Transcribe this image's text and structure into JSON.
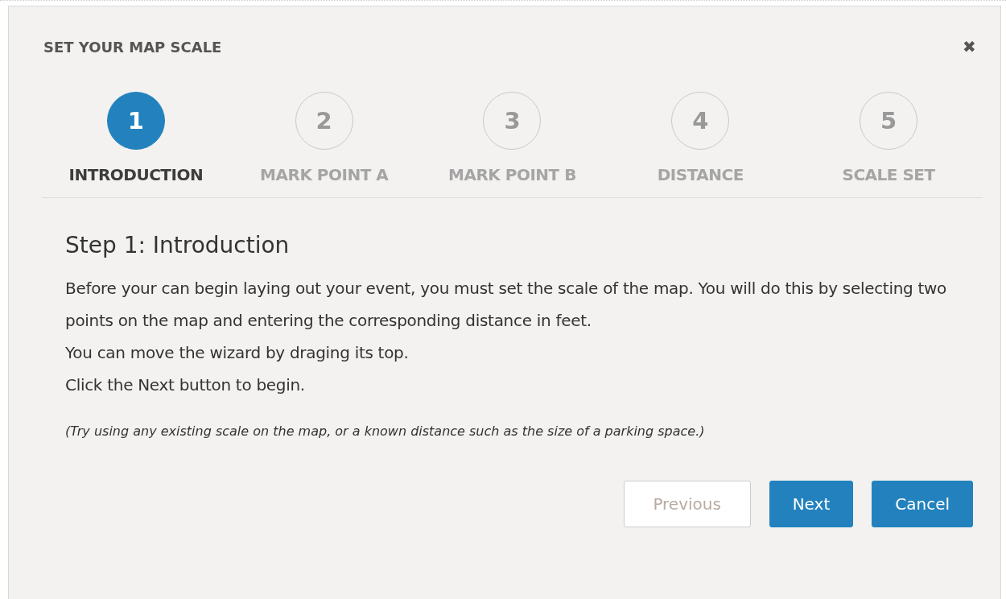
{
  "dialog": {
    "title": "SET YOUR MAP SCALE",
    "close": "✖"
  },
  "steps": [
    {
      "number": "1",
      "label": "INTRODUCTION",
      "selected": true
    },
    {
      "number": "2",
      "label": "MARK POINT A",
      "selected": false
    },
    {
      "number": "3",
      "label": "MARK POINT B",
      "selected": false
    },
    {
      "number": "4",
      "label": "DISTANCE",
      "selected": false
    },
    {
      "number": "5",
      "label": "SCALE SET",
      "selected": false
    }
  ],
  "heading": "Step 1: Introduction",
  "paragraphs": [
    "Before your can begin laying out your event, you must set the scale of the map. You will do this by selecting two points on the map and entering the corresponding distance in feet.",
    "You can move the wizard by draging its top.",
    "Click the Next button to begin."
  ],
  "note": "(Try using any existing scale on the map, or a known distance such as the size of a parking space.)",
  "buttons": [
    {
      "label": "Previous",
      "kind": "secondary",
      "disabled": true
    },
    {
      "label": "Next",
      "kind": "primary",
      "disabled": false
    },
    {
      "label": "Cancel",
      "kind": "primary",
      "disabled": false
    }
  ]
}
